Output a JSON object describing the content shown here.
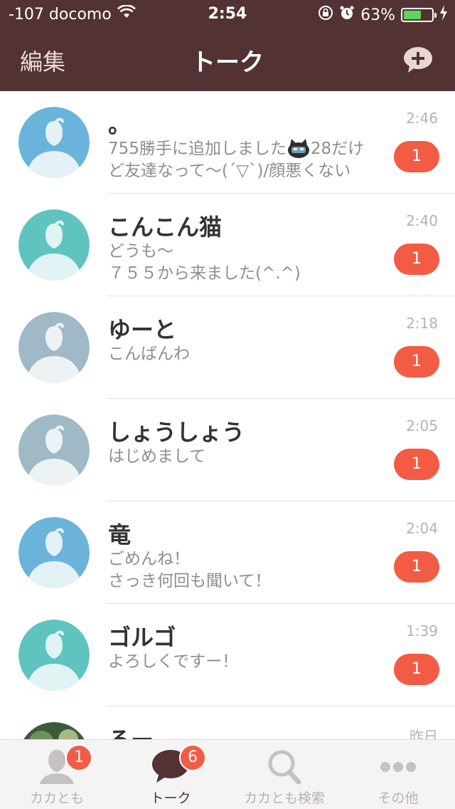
{
  "status": {
    "carrier": "-107 docomo",
    "time": "2:54",
    "battery": "63%",
    "battery_level": 0.63
  },
  "nav": {
    "edit_label": "編集",
    "title": "トーク"
  },
  "chats": [
    {
      "name": "。",
      "line1": "755勝手に追加しました",
      "line1b": "28だけ",
      "line2": "ど友達なって〜(´▽`)/顔悪くない",
      "time": "2:46",
      "unread": "1",
      "avatar_color": "#6ab4db"
    },
    {
      "name": "こんこん猫",
      "line1": "どうも〜",
      "line2": "７５５から来ました(^.^)",
      "time": "2:40",
      "unread": "1",
      "avatar_color": "#5fc4c0"
    },
    {
      "name": "ゆーと",
      "line1": "こんばんわ",
      "line2": "",
      "time": "2:18",
      "unread": "1",
      "avatar_color": "#9fb9c6"
    },
    {
      "name": "しょうしょう",
      "line1": "はじめまして",
      "line2": "",
      "time": "2:05",
      "unread": "1",
      "avatar_color": "#9fb9c6"
    },
    {
      "name": "竜",
      "line1": "ごめんね！",
      "line2": "さっき何回も聞いて！",
      "time": "2:04",
      "unread": "1",
      "avatar_color": "#6ab4db"
    },
    {
      "name": "ゴルゴ",
      "line1": "よろしくですー！",
      "line2": "",
      "time": "1:39",
      "unread": "1",
      "avatar_color": "#5fc4c0"
    },
    {
      "name": "るー",
      "line1": "",
      "line2": "",
      "time": "昨日",
      "unread": "",
      "avatar_color": "#3b5a3a"
    }
  ],
  "tabs": [
    {
      "label": "カカとも",
      "badge": "1",
      "icon": "person-icon"
    },
    {
      "label": "トーク",
      "badge": "6",
      "icon": "chat-bubble-icon"
    },
    {
      "label": "カカとも検索",
      "badge": "",
      "icon": "search-icon"
    },
    {
      "label": "その他",
      "badge": "",
      "icon": "more-dots-icon"
    }
  ],
  "colors": {
    "header_bg": "#523233",
    "badge": "#f25c45",
    "battery": "#5cd65c"
  }
}
